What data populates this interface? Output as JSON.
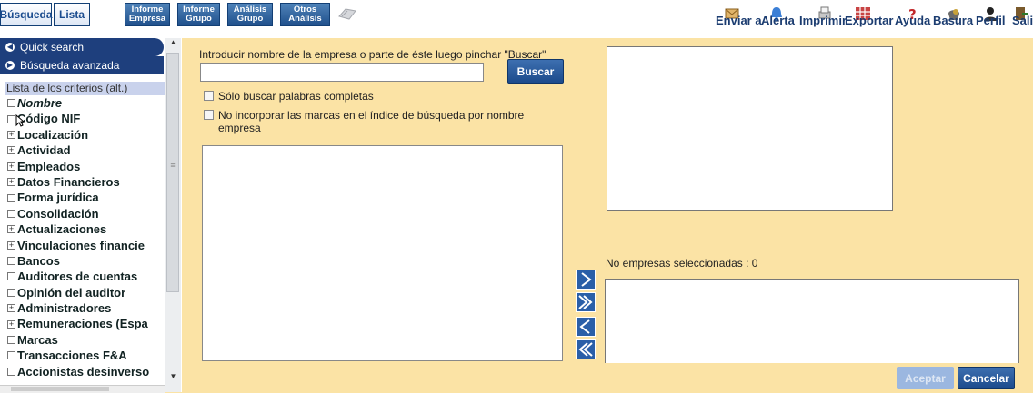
{
  "tabs": [
    {
      "label": "Búsqueda",
      "active": true
    },
    {
      "label": "Lista",
      "active": true
    },
    {
      "label": "Informe Empresa",
      "active": false
    },
    {
      "label": "Informe Grupo",
      "active": false
    },
    {
      "label": "Análisis Grupo",
      "active": false
    },
    {
      "label": "Otros Análisis",
      "active": false
    }
  ],
  "toolbar": {
    "send": "Enviar a",
    "alert": "Alerta",
    "print": "Imprimir",
    "export": "Exportar",
    "help": "Ayuda",
    "trash": "Basura",
    "profile": "Perfil",
    "exit": "Salir"
  },
  "sidebar": {
    "quick_search": "Quick search",
    "advanced_search": "Búsqueda avanzada",
    "criteria_header": "Lista de los criterios (alt.)",
    "items": [
      {
        "label": "Nombre",
        "expander": "□",
        "italic": true
      },
      {
        "label": "Código NIF",
        "expander": "□"
      },
      {
        "label": "Localización",
        "expander": "+"
      },
      {
        "label": "Actividad",
        "expander": "+"
      },
      {
        "label": "Empleados",
        "expander": "+"
      },
      {
        "label": "Datos Financieros",
        "expander": "+"
      },
      {
        "label": "Forma jurídica",
        "expander": "□"
      },
      {
        "label": "Consolidación",
        "expander": "□"
      },
      {
        "label": "Actualizaciones",
        "expander": "+"
      },
      {
        "label": "Vinculaciones financie",
        "expander": "+"
      },
      {
        "label": "Bancos",
        "expander": "□"
      },
      {
        "label": "Auditores de cuentas",
        "expander": "□"
      },
      {
        "label": "Opinión del auditor",
        "expander": "□"
      },
      {
        "label": "Administradores",
        "expander": "+"
      },
      {
        "label": "Remuneraciones (Espa",
        "expander": "+"
      },
      {
        "label": "Marcas",
        "expander": "□"
      },
      {
        "label": "Transacciones F&A",
        "expander": "□"
      },
      {
        "label": "Accionistas desinverso",
        "expander": "□"
      }
    ]
  },
  "search": {
    "instruction": "Introducir nombre de la empresa o parte de éste luego pinchar \"Buscar\"",
    "value": "",
    "button": "Buscar",
    "whole_words": "Sólo buscar palabras completas",
    "exclude_brands": "No incorporar las marcas en el índice de búsqueda por nombre empresa"
  },
  "selection": {
    "count_label": "No empresas seleccionadas : 0",
    "arrows": [
      "add-one",
      "add-all",
      "remove-one",
      "remove-all"
    ]
  },
  "footer": {
    "accept": "Aceptar",
    "cancel": "Cancelar"
  },
  "colors": {
    "background": "#fbe3a5",
    "primary": "#1e3f7d",
    "button": "#2a5fa8"
  }
}
